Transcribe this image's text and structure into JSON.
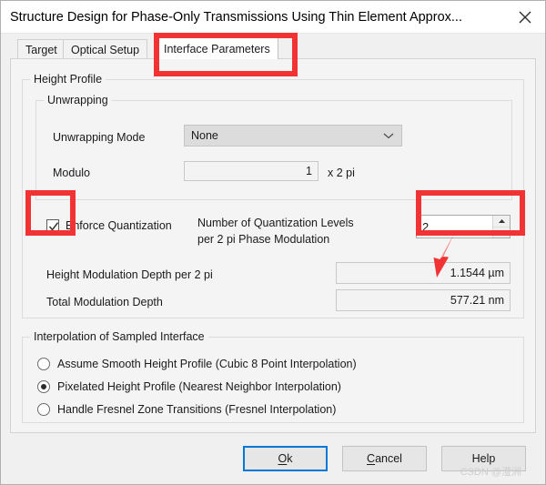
{
  "window": {
    "title": "Structure Design for Phase-Only Transmissions Using Thin Element Approx...",
    "close_icon": "close-icon"
  },
  "tabs": [
    {
      "label": "Target",
      "selected": false
    },
    {
      "label": "Optical Setup",
      "selected": false
    },
    {
      "label": "Interface Parameters",
      "selected": true
    }
  ],
  "height_profile": {
    "legend": "Height Profile",
    "unwrapping": {
      "legend": "Unwrapping",
      "mode_label": "Unwrapping Mode",
      "mode_value": "None",
      "mode_options": "None",
      "modulo_label": "Modulo",
      "modulo_value": "1",
      "modulo_unit": "x 2 pi"
    },
    "quantization": {
      "checkbox_label": "Enforce Quantization",
      "checkbox_checked": "checked",
      "levels_label_line1": "Number of Quantization Levels",
      "levels_label_line2": "per 2 pi Phase Modulation",
      "levels_value": "2"
    },
    "depth": {
      "height_modulation_label": "Height Modulation Depth per 2 pi",
      "height_modulation_value": "1.1544 µm",
      "total_modulation_label": "Total Modulation Depth",
      "total_modulation_value": "577.21 nm"
    }
  },
  "interpolation": {
    "legend": "Interpolation of Sampled Interface",
    "options": [
      {
        "label": "Assume Smooth Height Profile (Cubic 8 Point Interpolation)",
        "selected": false
      },
      {
        "label": "Pixelated Height Profile (Nearest Neighbor Interpolation)",
        "selected": true
      },
      {
        "label": "Handle Fresnel Zone Transitions (Fresnel Interpolation)",
        "selected": false
      }
    ]
  },
  "buttons": {
    "ok": "Ok",
    "ok_accel": "O",
    "ok_rest": "k",
    "cancel_accel": "C",
    "cancel_rest": "ancel",
    "help": "Help"
  },
  "annotations": {
    "highlight_color": "#f23333",
    "arrow_color": "#f23333",
    "highlighted_tab": "Interface Parameters",
    "highlighted_checkbox": "Enforce Quantization",
    "highlighted_field": "Number of Quantization Levels"
  },
  "watermark": "CSDN @澄洲"
}
